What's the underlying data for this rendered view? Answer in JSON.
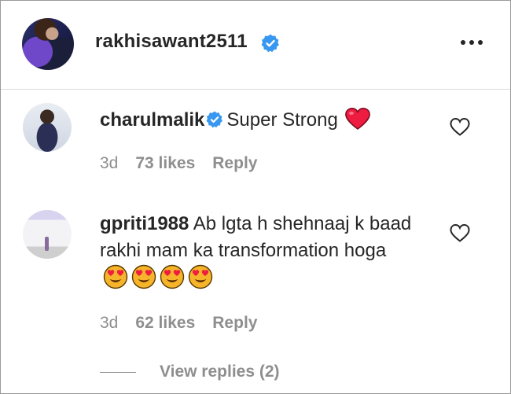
{
  "post": {
    "username": "rakhisawant2511"
  },
  "comments": [
    {
      "username": "charulmalik",
      "text": "Super Strong",
      "time": "3d",
      "likes": "73 likes",
      "reply": "Reply"
    },
    {
      "username": "gpriti1988",
      "text": "Ab lgta h shehnaaj k baad rakhi mam ka transformation hoga",
      "time": "3d",
      "likes": "62 likes",
      "reply": "Reply"
    }
  ],
  "view_replies": "View replies (2)",
  "colors": {
    "verified": "#3897f0",
    "heart": "#ed1c40",
    "muted": "#8e8e8e"
  }
}
